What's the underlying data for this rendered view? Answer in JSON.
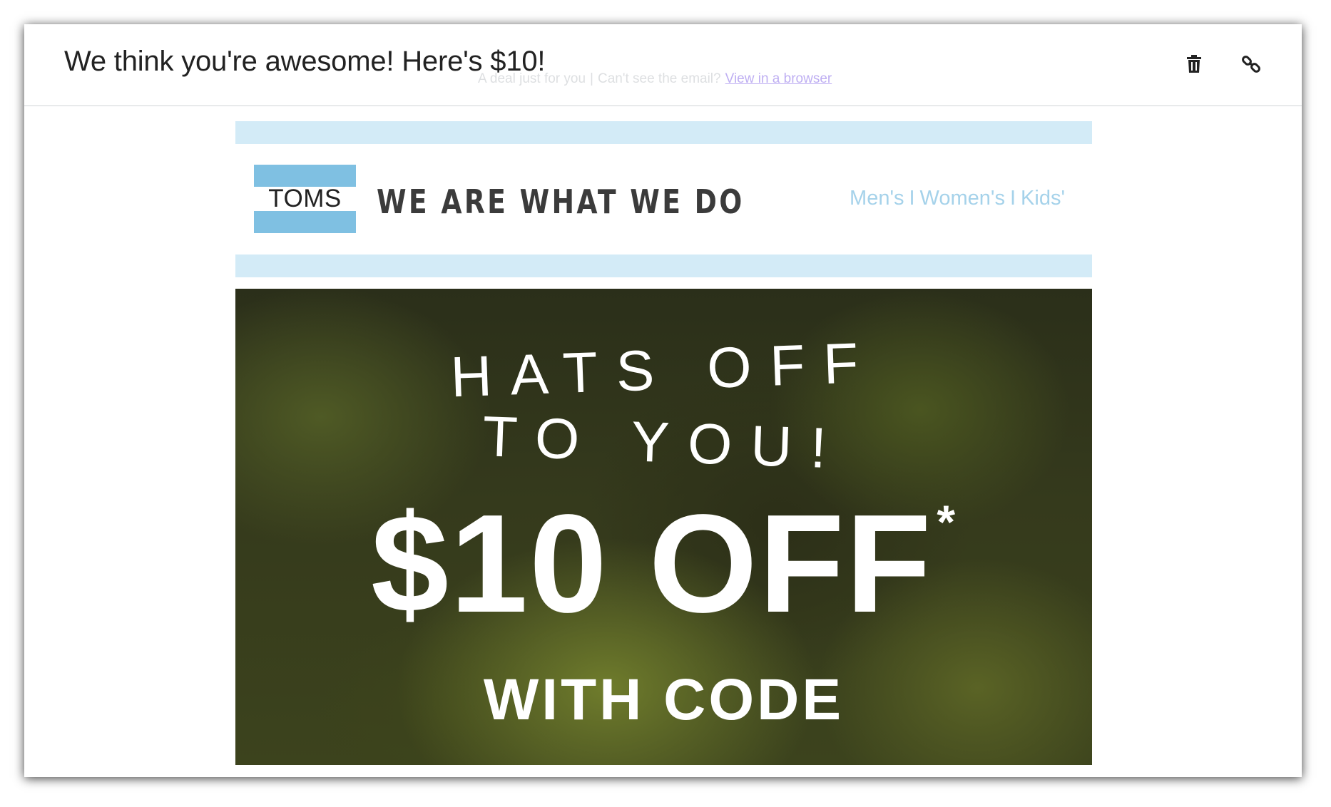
{
  "header": {
    "subject": "We think you're awesome! Here's $10!",
    "icons": [
      "trash-icon",
      "link-icon"
    ]
  },
  "preheader": {
    "text": "A deal just for you",
    "separator": "|",
    "cant_see": "Can't see the email?",
    "link": "View in a browser"
  },
  "brand": {
    "logo_text": "TOMS",
    "tagline": "WE ARE WHAT WE DO",
    "nav": [
      "Men's",
      "Women's",
      "Kids'"
    ],
    "nav_separator": "I",
    "colors": {
      "bar": "#d3ebf7",
      "flag_blue": "#7fc0e2",
      "nav": "#a5d2ea"
    }
  },
  "hero": {
    "line1": "HATS OFF",
    "line2": "TO YOU!",
    "offer": "$10 OFF",
    "asterisk": "*",
    "code_line": "WITH CODE"
  }
}
